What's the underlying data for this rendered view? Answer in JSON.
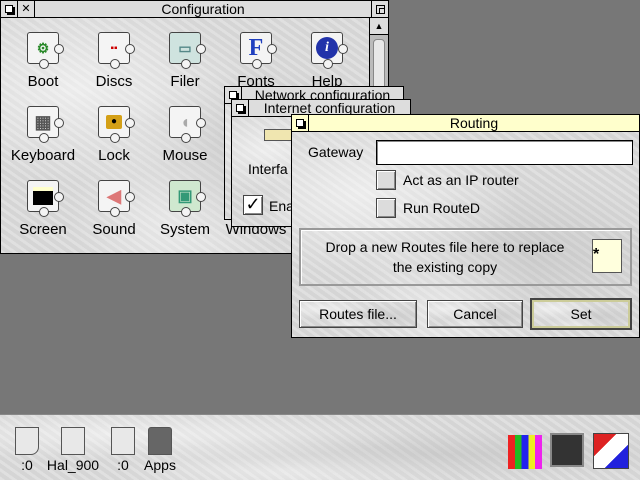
{
  "configuration": {
    "title": "Configuration",
    "items": [
      {
        "label": "Boot",
        "icon": "boot-icon"
      },
      {
        "label": "Discs",
        "icon": "discs-icon"
      },
      {
        "label": "Filer",
        "icon": "filer-icon"
      },
      {
        "label": "Fonts",
        "icon": "fonts-icon",
        "glyph": "F"
      },
      {
        "label": "Help",
        "icon": "help-icon",
        "glyph": "i"
      },
      {
        "label": "Keyboard",
        "icon": "keyboard-icon"
      },
      {
        "label": "Lock",
        "icon": "lock-icon"
      },
      {
        "label": "Mouse",
        "icon": "mouse-icon"
      },
      {
        "label": "Screen",
        "icon": "screen-icon"
      },
      {
        "label": "Sound",
        "icon": "sound-icon"
      },
      {
        "label": "System",
        "icon": "system-icon"
      },
      {
        "label": "Windows",
        "icon": "windows-icon"
      }
    ]
  },
  "network": {
    "title": "Network configuration",
    "interfaces_partial": "Interfa",
    "enable_partial": "Ena",
    "check_mark": "✓"
  },
  "internet": {
    "title": "Internet configuration"
  },
  "routing": {
    "title": "Routing",
    "gateway_label": "Gateway",
    "gateway_value": "",
    "ip_router_label": "Act as an IP router",
    "routed_label": "Run RouteD",
    "drop_text_line1": "Drop a new Routes file here to replace",
    "drop_text_line2": "the existing copy",
    "routes_file_button": "Routes file...",
    "cancel_button": "Cancel",
    "set_button": "Set"
  },
  "iconbar": {
    "left_items": [
      {
        "label": ":0",
        "icon": "cd-drive-icon"
      },
      {
        "label": "Hal_900",
        "icon": "hard-disc-icon"
      },
      {
        "label": ":0",
        "icon": "floppy-drive-icon"
      },
      {
        "label": "Apps",
        "icon": "apps-folder-icon"
      }
    ],
    "right_items": [
      {
        "icon": "palette-icon"
      },
      {
        "icon": "task-display-icon"
      },
      {
        "icon": "switcher-icon"
      }
    ]
  },
  "colors": {
    "desktop": "#777777",
    "titlebar_inactive": "#dddddd",
    "titlebar_active": "#ffffcc",
    "fonts_blue": "#1f3fbf",
    "help_blue": "#2233aa"
  }
}
